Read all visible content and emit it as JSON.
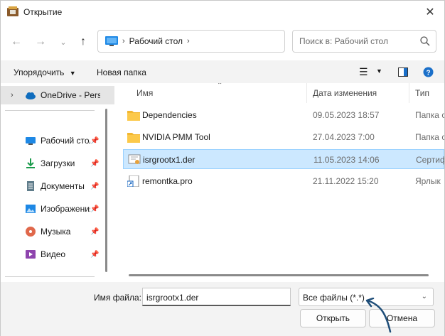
{
  "window": {
    "title": "Открытие"
  },
  "address": {
    "crumb": "Рабочий стол"
  },
  "search": {
    "placeholder": "Поиск в: Рабочий стол"
  },
  "toolbar": {
    "organize": "Упорядочить",
    "new_folder": "Новая папка"
  },
  "sidebar": {
    "onedrive": "OneDrive - Personal",
    "items": [
      {
        "label": "Рабочий стол",
        "icon": "desktop-icon",
        "pinned": true
      },
      {
        "label": "Загрузки",
        "icon": "download-icon",
        "pinned": true
      },
      {
        "label": "Документы",
        "icon": "document-icon",
        "pinned": true
      },
      {
        "label": "Изображения",
        "icon": "image-icon",
        "pinned": true
      },
      {
        "label": "Музыка",
        "icon": "music-icon",
        "pinned": true
      },
      {
        "label": "Видео",
        "icon": "video-icon",
        "pinned": true
      }
    ]
  },
  "columns": {
    "name": "Имя",
    "date": "Дата изменения",
    "type": "Тип"
  },
  "files": [
    {
      "name": "Dependencies",
      "date": "09.05.2023 18:57",
      "type": "Папка с файлами",
      "icon": "folder-icon"
    },
    {
      "name": "NVIDIA PMM Tool",
      "date": "27.04.2023 7:00",
      "type": "Папка с файлами",
      "icon": "folder-icon"
    },
    {
      "name": "isrgrootx1.der",
      "date": "11.05.2023 14:06",
      "type": "Сертификат",
      "icon": "certificate-icon",
      "selected": true
    },
    {
      "name": "remontka.pro",
      "date": "21.11.2022 15:20",
      "type": "Ярлык",
      "icon": "shortcut-icon"
    }
  ],
  "bottom": {
    "filename_label": "Имя файла:",
    "filename_value": "isrgrootx1.der",
    "filetype": "Все файлы (*.*)",
    "open": "Открыть",
    "cancel": "Отмена"
  },
  "colors": {
    "accent": "#0067c0",
    "selection": "#cce8ff",
    "annotation_arrow": "#1f4e79"
  }
}
